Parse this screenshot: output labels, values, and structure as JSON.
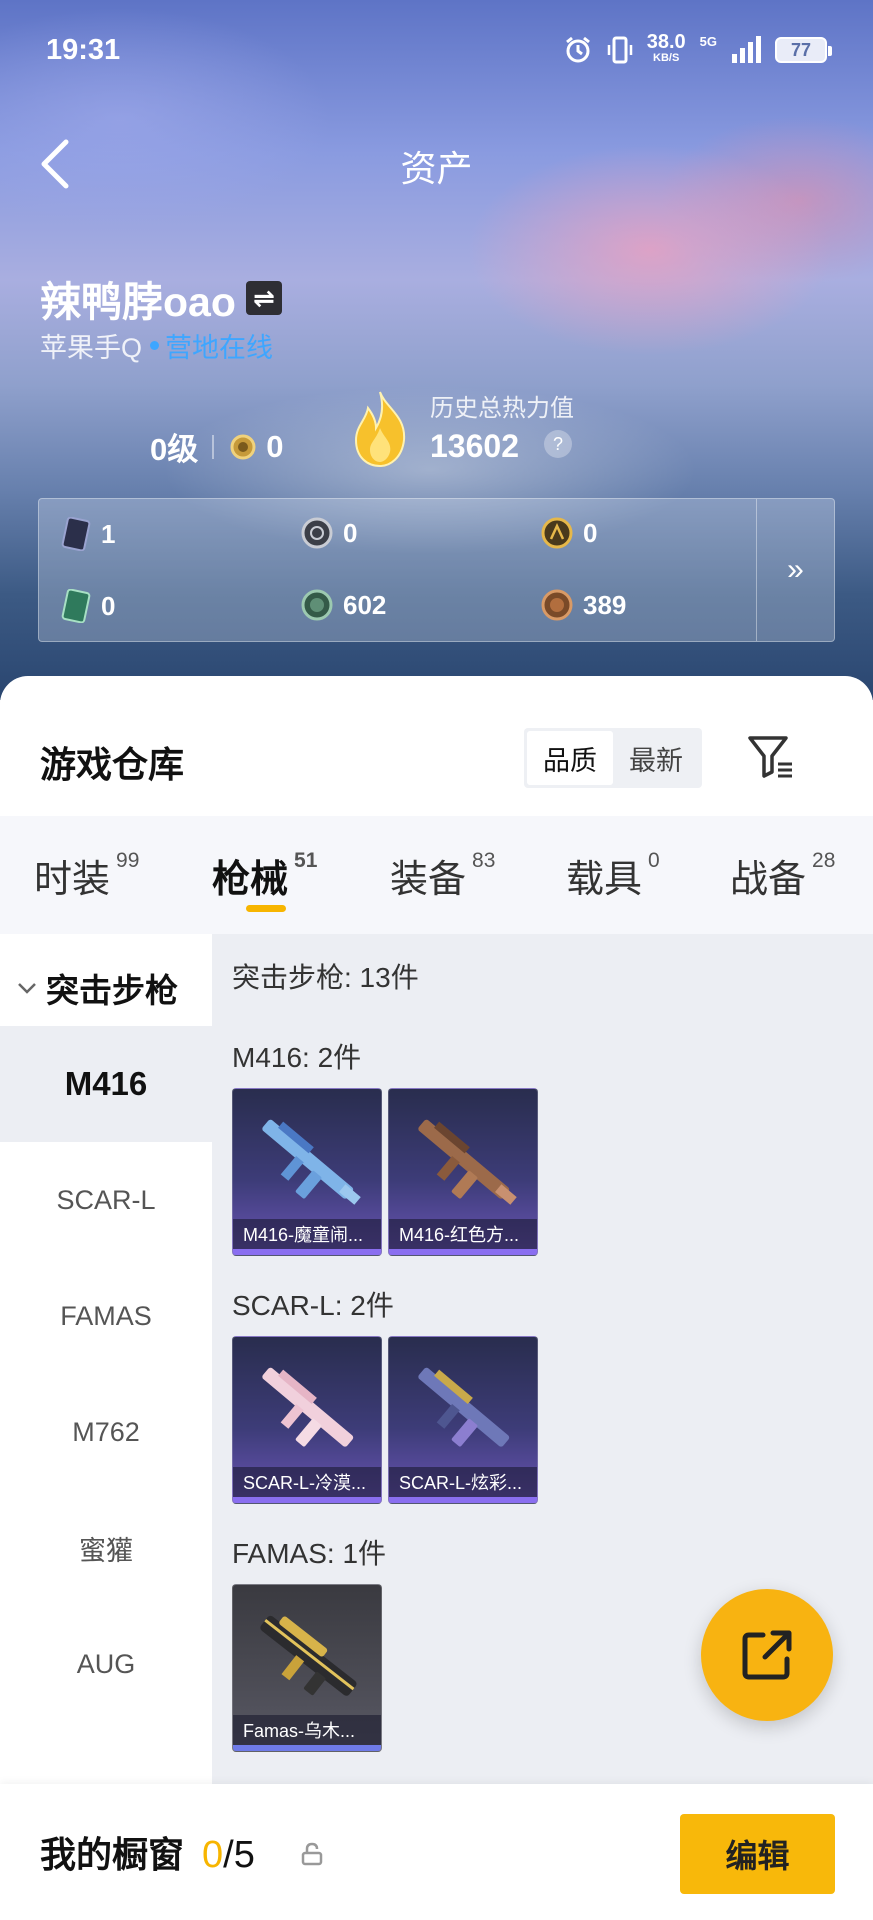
{
  "status_bar": {
    "time": "19:31",
    "net_speed": "38.0",
    "net_unit": "KB/S",
    "signal": "5G",
    "battery": "77"
  },
  "header": {
    "title": "资产"
  },
  "profile": {
    "username": "辣鸭脖oao",
    "platform": "苹果手Q",
    "online_status": "营地在线",
    "level": "0级",
    "badge_count": "0",
    "heat_label": "历史总热力值",
    "heat_value": "13602",
    "help": "?"
  },
  "currencies": [
    {
      "icon": "ticket-icon",
      "value": "1"
    },
    {
      "icon": "silver-coin-icon",
      "value": "0"
    },
    {
      "icon": "gold-token-icon",
      "value": "0"
    },
    {
      "icon": "green-card-icon",
      "value": "0"
    },
    {
      "icon": "green-coin-icon",
      "value": "602"
    },
    {
      "icon": "bronze-coin-icon",
      "value": "389"
    }
  ],
  "warehouse": {
    "title": "游戏仓库",
    "sort_options": [
      "品质",
      "最新"
    ],
    "sort_selected": "品质"
  },
  "tabs": [
    {
      "label": "时装",
      "count": "99"
    },
    {
      "label": "枪械",
      "count": "51",
      "active": true
    },
    {
      "label": "装备",
      "count": "83"
    },
    {
      "label": "载具",
      "count": "0"
    },
    {
      "label": "战备",
      "count": "28"
    }
  ],
  "sidebar": {
    "category": "突击步枪",
    "items": [
      "M416",
      "SCAR-L",
      "FAMAS",
      "M762",
      "蜜獾",
      "AUG"
    ],
    "selected": "M416"
  },
  "content": {
    "summary": "突击步枪: 13件",
    "groups": [
      {
        "title": "M416: 2件",
        "items": [
          {
            "label": "M416-魔童闹..."
          },
          {
            "label": "M416-红色方..."
          }
        ]
      },
      {
        "title": "SCAR-L: 2件",
        "items": [
          {
            "label": "SCAR-L-冷漠..."
          },
          {
            "label": "SCAR-L-炫彩..."
          }
        ]
      },
      {
        "title": "FAMAS: 1件",
        "items": [
          {
            "label": "Famas-乌木..."
          }
        ]
      }
    ]
  },
  "showcase": {
    "title": "我的橱窗",
    "current": "0",
    "total": "/5",
    "edit_label": "编辑"
  },
  "colors": {
    "accent": "#f7b500",
    "online": "#3ea6ff",
    "card_purple": "#6a55b6"
  }
}
